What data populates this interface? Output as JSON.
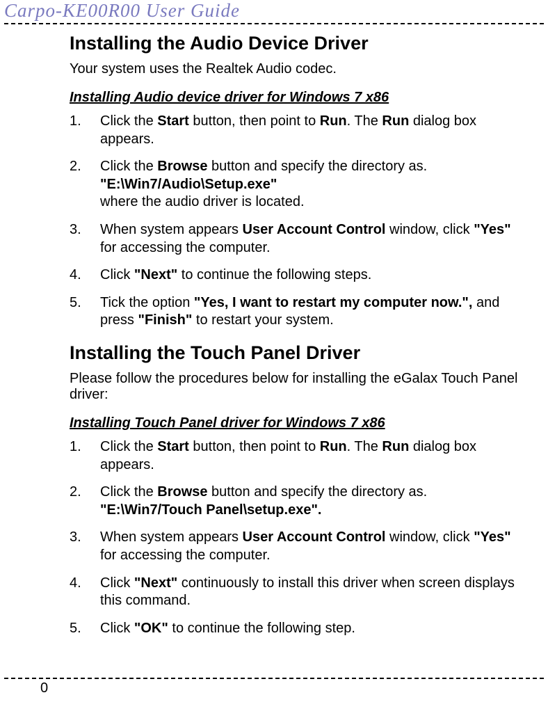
{
  "header": {
    "title": "Carpo-KE00R00  User  Guide"
  },
  "section1": {
    "heading": "Installing the Audio Device Driver",
    "intro": "Your system uses the Realtek Audio codec.",
    "subheading": "Installing Audio device driver for Windows 7 x86",
    "steps": {
      "s1_a": "Click the ",
      "s1_b": "Start",
      "s1_c": " button, then point to ",
      "s1_d": "Run",
      "s1_e": ". The ",
      "s1_f": "Run",
      "s1_g": " dialog box appears.",
      "s2_a": "Click the ",
      "s2_b": "Browse",
      "s2_c": " button and specify the directory as.",
      "s2_d": "\"E:\\Win7/Audio\\Setup.exe\"",
      "s2_e": "where the audio driver is located.",
      "s3_a": "When system appears ",
      "s3_b": "User Account Control",
      "s3_c": " window, click ",
      "s3_d": "\"Yes\"",
      "s3_e": " for accessing the computer.",
      "s4_a": "Click ",
      "s4_b": "\"Next\"",
      "s4_c": " to continue the following steps.",
      "s5_a": "Tick the option ",
      "s5_b": "\"Yes, I want to restart my computer now.\",",
      "s5_c": " and press ",
      "s5_d": "\"Finish\"",
      "s5_e": " to restart your system."
    }
  },
  "section2": {
    "heading": "Installing the Touch Panel Driver",
    "intro": "Please follow the procedures below for installing the eGalax Touch Panel driver:",
    "subheading": "Installing Touch Panel driver for Windows 7 x86",
    "steps": {
      "s1_a": "Click the ",
      "s1_b": "Start",
      "s1_c": " button, then point to ",
      "s1_d": "Run",
      "s1_e": ". The ",
      "s1_f": "Run",
      "s1_g": " dialog box appears.",
      "s2_a": "Click the ",
      "s2_b": "Browse",
      "s2_c": " button and specify the directory as.",
      "s2_d": "\"E:\\Win7/Touch Panel\\setup.exe\".",
      "s3_a": "When system appears ",
      "s3_b": "User Account Control",
      "s3_c": " window, click ",
      "s3_d": "\"Yes\"",
      "s3_e": " for accessing the computer.",
      "s4_a": "Click ",
      "s4_b": "\"Next\"",
      "s4_c": " continuously to install this driver when screen displays this command.",
      "s5_a": "Click ",
      "s5_b": "\"OK\"",
      "s5_c": " to continue the following step."
    }
  },
  "footer": {
    "page_number": "0"
  }
}
